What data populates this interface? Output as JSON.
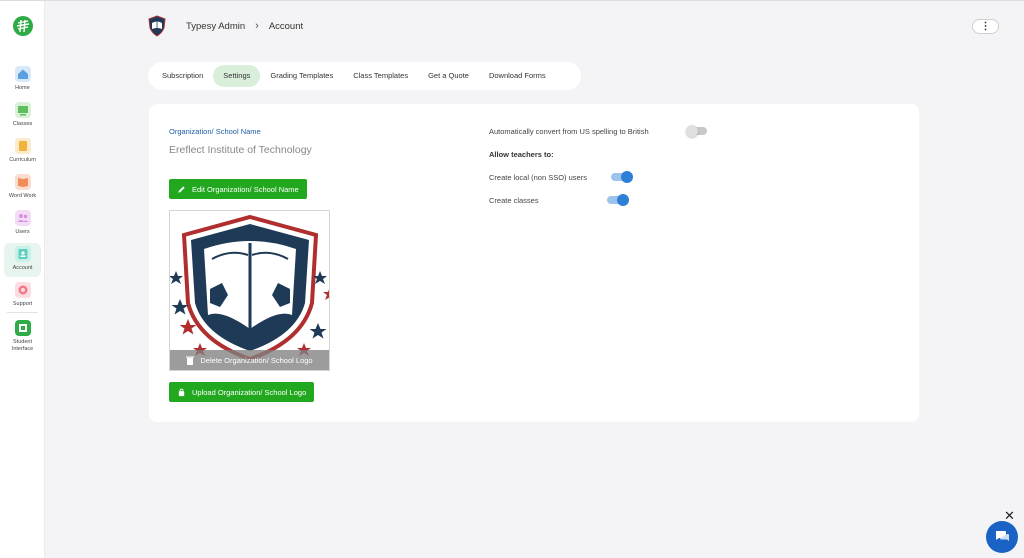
{
  "sidebar": {
    "logo_icon": "typesy-logo-icon",
    "items": [
      {
        "label": "Home",
        "icon": "home-icon",
        "color": "#5aa0e0"
      },
      {
        "label": "Classes",
        "icon": "classes-icon",
        "color": "#5cbf5c"
      },
      {
        "label": "Curriculum",
        "icon": "curriculum-icon",
        "color": "#f0b43c"
      },
      {
        "label": "Word Work",
        "icon": "book-icon",
        "color": "#f08c5a"
      },
      {
        "label": "Users",
        "icon": "users-icon",
        "color": "#d88fe0"
      },
      {
        "label": "Account",
        "icon": "account-icon",
        "color": "#5ccfc0"
      },
      {
        "label": "Support",
        "icon": "support-icon",
        "color": "#f07a8a"
      },
      {
        "label": "Student Interface",
        "icon": "student-interface-icon",
        "color": "#2eaa46"
      }
    ],
    "active": "Account"
  },
  "header": {
    "breadcrumb_root": "Typesy Admin",
    "breadcrumb_current": "Account",
    "menu_icon": "more-vertical-icon"
  },
  "tabs": [
    {
      "label": "Subscription",
      "active": false
    },
    {
      "label": "Settings",
      "active": true
    },
    {
      "label": "Grading Templates",
      "active": false
    },
    {
      "label": "Class Templates",
      "active": false
    },
    {
      "label": "Get a Quote",
      "active": false
    },
    {
      "label": "Download Forms",
      "active": false
    }
  ],
  "org": {
    "label": "Organization/ School Name",
    "name": "Ereflect Institute of Technology",
    "edit_button": "Edit Organization/ School Name",
    "delete_logo": "Delete Organization/ School Logo",
    "upload_button": "Upload Organization/ School Logo"
  },
  "settings": {
    "auto_convert_label": "Automatically convert from US spelling to British",
    "auto_convert_on": false,
    "allow_heading": "Allow teachers to:",
    "create_local_label": "Create local (non SSO) users",
    "create_local_on": true,
    "create_classes_label": "Create classes",
    "create_classes_on": true
  },
  "colors": {
    "accent_green": "#22a81e",
    "link_blue": "#1f5ea8",
    "toggle_blue": "#2f7fd6",
    "active_tab_bg": "#d9efd9"
  },
  "chat": {
    "close_icon": "close-icon",
    "chat_icon": "chat-bubble-icon"
  }
}
